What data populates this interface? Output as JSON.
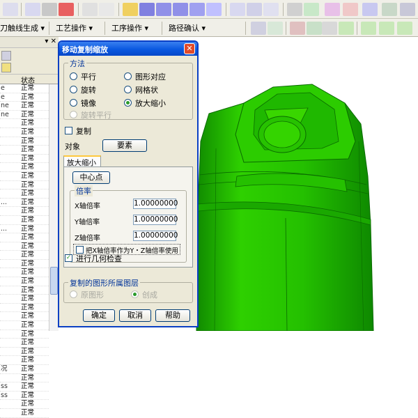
{
  "toolbar2": {
    "menu1": "刀触线生成 ▾",
    "menu2": "工艺操作 ▾",
    "menu3": "工序操作 ▾",
    "menu4": "路径确认 ▾"
  },
  "left_panel": {
    "col_status": "状态",
    "rows": [
      {
        "c1": "e",
        "c2": "正常"
      },
      {
        "c1": "e",
        "c2": "正常"
      },
      {
        "c1": "ne",
        "c2": "正常"
      },
      {
        "c1": "ne",
        "c2": "正常"
      },
      {
        "c1": "",
        "c2": "正常"
      },
      {
        "c1": "",
        "c2": "正常"
      },
      {
        "c1": "",
        "c2": "正常"
      },
      {
        "c1": "",
        "c2": "正常"
      },
      {
        "c1": "",
        "c2": "正常"
      },
      {
        "c1": "",
        "c2": "正常"
      },
      {
        "c1": "",
        "c2": "正常"
      },
      {
        "c1": "",
        "c2": "正常"
      },
      {
        "c1": "",
        "c2": "正常"
      },
      {
        "c1": "...",
        "c2": "正常"
      },
      {
        "c1": "",
        "c2": "正常"
      },
      {
        "c1": "",
        "c2": "正常"
      },
      {
        "c1": "...",
        "c2": "正常"
      },
      {
        "c1": "",
        "c2": "正常"
      },
      {
        "c1": "",
        "c2": "正常"
      },
      {
        "c1": "",
        "c2": "正常"
      },
      {
        "c1": "",
        "c2": "正常"
      },
      {
        "c1": "",
        "c2": "正常"
      },
      {
        "c1": "",
        "c2": "正常"
      },
      {
        "c1": "",
        "c2": "正常"
      },
      {
        "c1": "",
        "c2": "正常"
      },
      {
        "c1": "",
        "c2": "正常"
      },
      {
        "c1": "",
        "c2": "正常"
      },
      {
        "c1": "",
        "c2": "正常"
      },
      {
        "c1": "",
        "c2": "正常"
      },
      {
        "c1": "",
        "c2": "正常"
      },
      {
        "c1": "",
        "c2": "正常"
      },
      {
        "c1": "",
        "c2": "正常"
      },
      {
        "c1": "况",
        "c2": "正常"
      },
      {
        "c1": "",
        "c2": "正常"
      },
      {
        "c1": "ss",
        "c2": "正常"
      },
      {
        "c1": "ss",
        "c2": "正常"
      },
      {
        "c1": "",
        "c2": "正常"
      },
      {
        "c1": "",
        "c2": "正常"
      }
    ]
  },
  "dialog": {
    "title": "移动复制缩放",
    "method_group": "方法",
    "method_options": {
      "translate": "平行",
      "rotate": "旋转",
      "mirror": "镜像",
      "rotate_parallel": "旋转平行",
      "shape_corr": "图形对应",
      "grid": "网格状",
      "scale": "放大缩小"
    },
    "copy_label": "复制",
    "object_label": "对象",
    "element_button": "要素",
    "tab_label": "放大缩小",
    "center_button": "中心点",
    "scale_group": "倍率",
    "x_label": "X轴倍率",
    "y_label": "Y轴倍率",
    "z_label": "Z轴倍率",
    "x_value": "1.00000000",
    "y_value": "1.00000000",
    "z_value": "1.00000000",
    "uniform_label": "把X轴倍率作为Y・Z轴倍率使用",
    "geom_check_label": "进行几何检查",
    "layer_group": "复制的图形所属图层",
    "layer_original": "原图形",
    "layer_create": "创成",
    "ok": "确定",
    "cancel": "取消",
    "help": "帮助"
  },
  "colors": {
    "model": "#22c000",
    "dialog_title": "#0a58e0"
  }
}
